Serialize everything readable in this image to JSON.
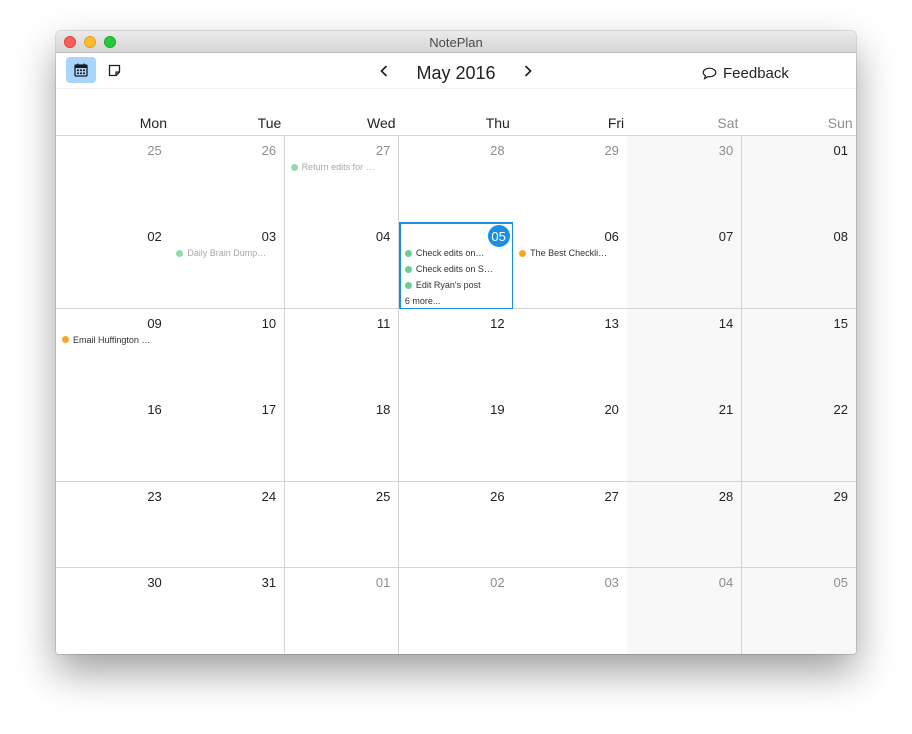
{
  "window": {
    "title": "NotePlan"
  },
  "toolbar": {
    "month_title": "May 2016",
    "feedback_label": "Feedback",
    "calendar_icon": "calendar-icon",
    "note_icon": "note-icon"
  },
  "colors": {
    "accent": "#1a8fe3",
    "green_event": "#6dcf8b",
    "orange_event": "#f5a623",
    "active_button": "#a9d4fb"
  },
  "weekdays": [
    "Mon",
    "Tue",
    "Wed",
    "Thu",
    "Fri",
    "Sat",
    "Sun"
  ],
  "weeks": [
    [
      {
        "day": "25",
        "other": true
      },
      {
        "day": "26",
        "other": true
      },
      {
        "day": "27",
        "other": true,
        "events": [
          {
            "text": "Return edits for …",
            "color": "green",
            "faded": true
          }
        ]
      },
      {
        "day": "28",
        "other": true
      },
      {
        "day": "29",
        "other": true
      },
      {
        "day": "30",
        "other": true
      },
      {
        "day": "01"
      }
    ],
    [
      {
        "day": "02"
      },
      {
        "day": "03",
        "events": [
          {
            "text": "Daily Brain Dump…",
            "color": "green",
            "faded": true
          }
        ]
      },
      {
        "day": "04"
      },
      {
        "day": "05",
        "today": true,
        "events": [
          {
            "text": "Check edits on…",
            "color": "green"
          },
          {
            "text": "Check edits on S…",
            "color": "green"
          },
          {
            "text": "Edit Ryan's post",
            "color": "green"
          }
        ],
        "more": "6 more..."
      },
      {
        "day": "06",
        "events": [
          {
            "text": "The Best Checkli…",
            "color": "orange"
          }
        ]
      },
      {
        "day": "07"
      },
      {
        "day": "08"
      }
    ],
    [
      {
        "day": "09",
        "events": [
          {
            "text": "Email Huffington …",
            "color": "orange"
          }
        ]
      },
      {
        "day": "10"
      },
      {
        "day": "11"
      },
      {
        "day": "12"
      },
      {
        "day": "13"
      },
      {
        "day": "14"
      },
      {
        "day": "15"
      }
    ],
    [
      {
        "day": "16"
      },
      {
        "day": "17"
      },
      {
        "day": "18"
      },
      {
        "day": "19"
      },
      {
        "day": "20"
      },
      {
        "day": "21"
      },
      {
        "day": "22"
      }
    ],
    [
      {
        "day": "23"
      },
      {
        "day": "24"
      },
      {
        "day": "25"
      },
      {
        "day": "26"
      },
      {
        "day": "27"
      },
      {
        "day": "28"
      },
      {
        "day": "29"
      }
    ],
    [
      {
        "day": "30"
      },
      {
        "day": "31"
      },
      {
        "day": "01",
        "other": true
      },
      {
        "day": "02",
        "other": true
      },
      {
        "day": "03",
        "other": true
      },
      {
        "day": "04",
        "other": true
      },
      {
        "day": "05",
        "other": true
      }
    ]
  ]
}
